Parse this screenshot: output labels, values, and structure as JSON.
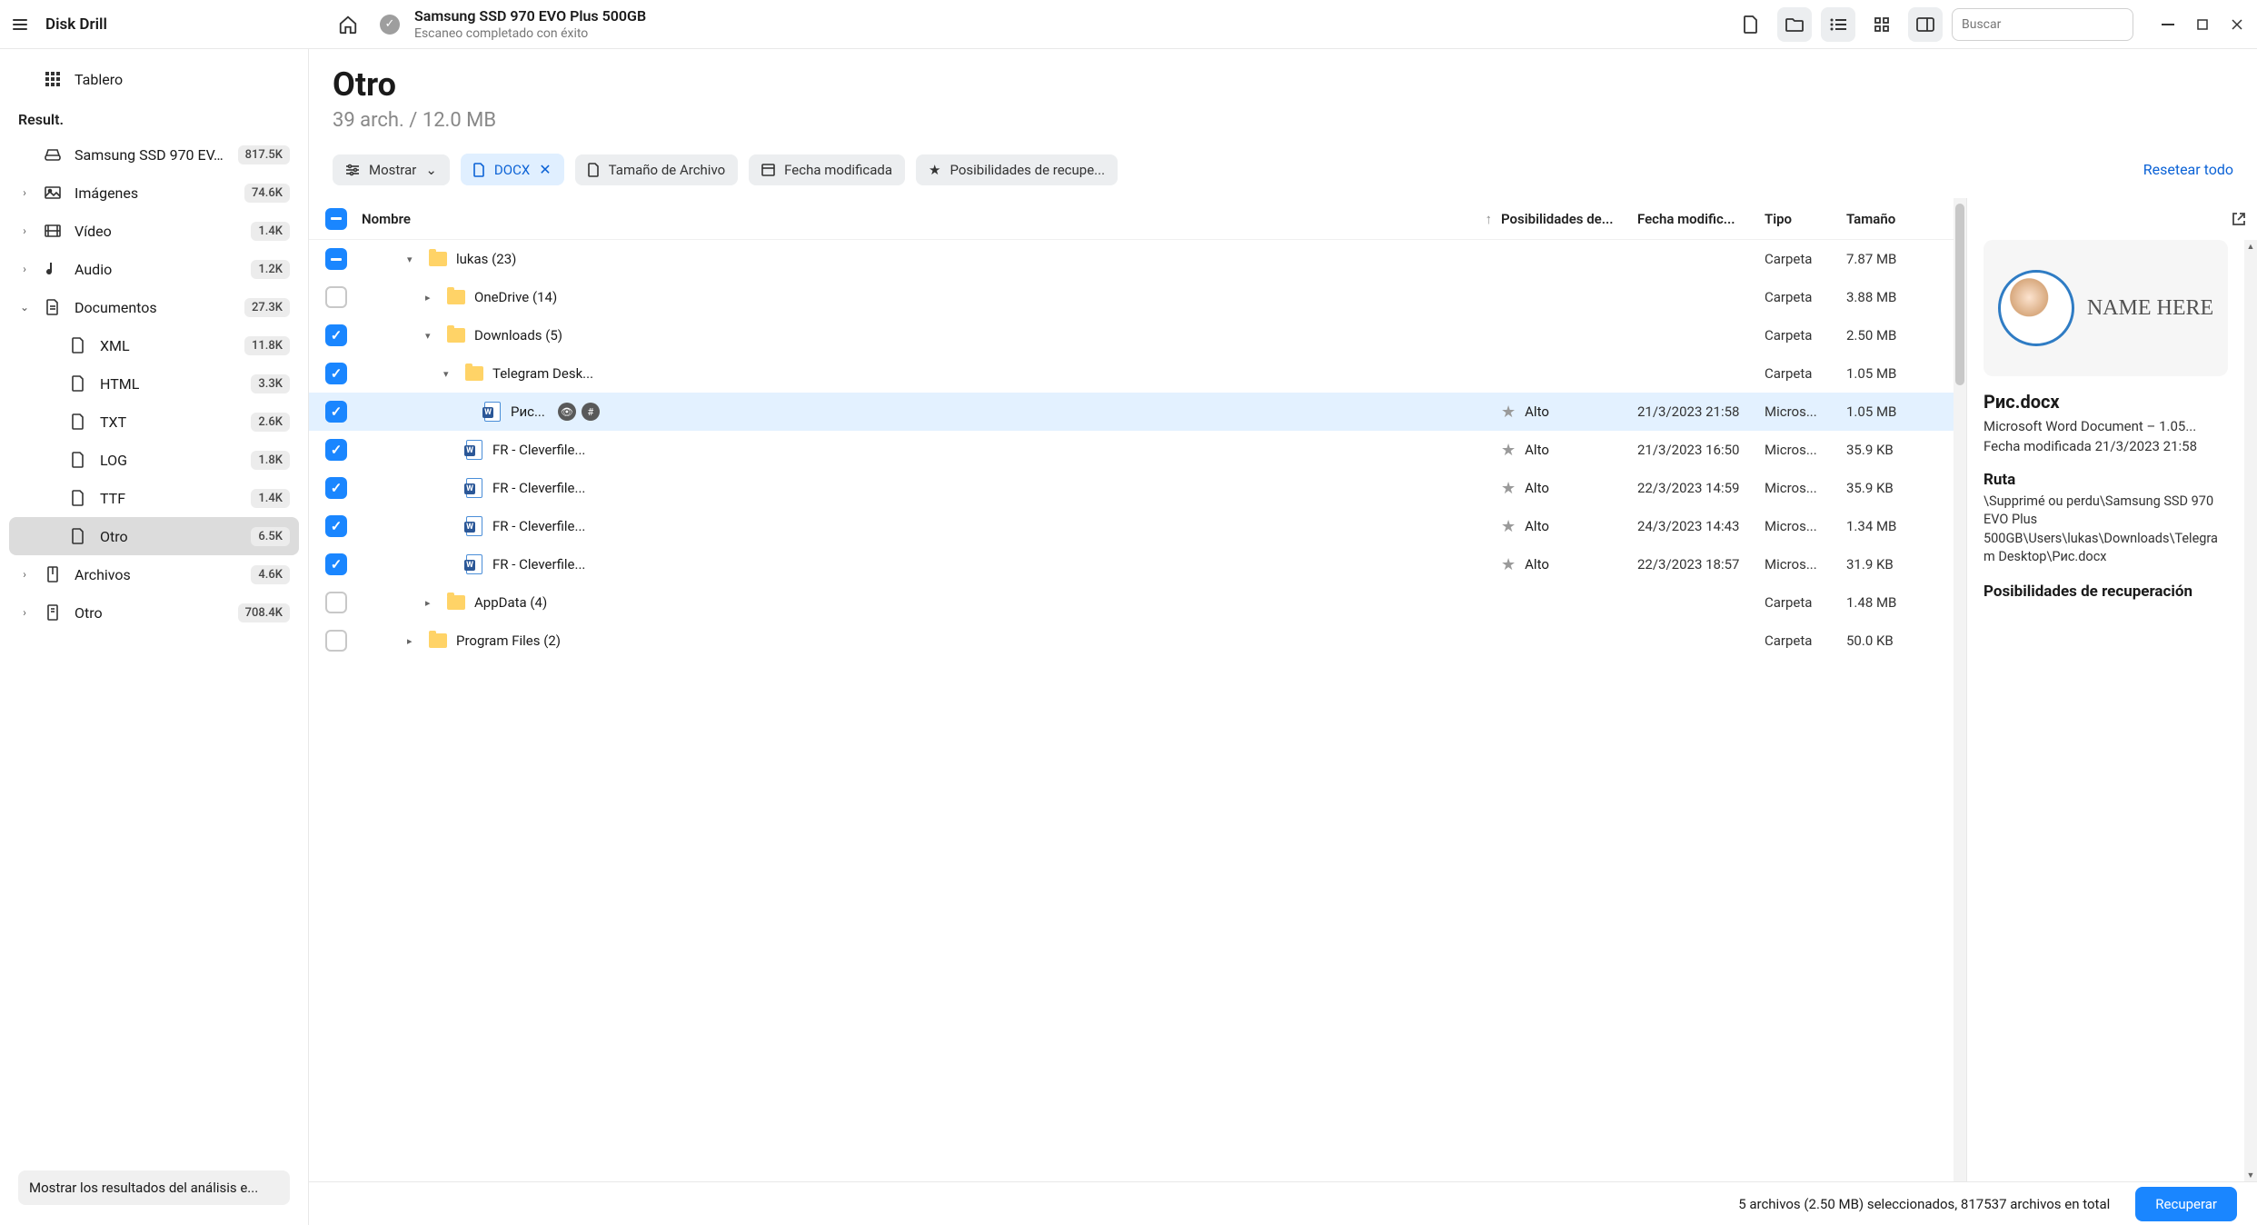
{
  "app": {
    "title": "Disk Drill"
  },
  "titlebar": {
    "disk_name": "Samsung SSD 970 EVO Plus 500GB",
    "scan_status": "Escaneo completado con éxito",
    "search_placeholder": "Buscar"
  },
  "sidebar": {
    "dashboard_label": "Tablero",
    "result_label": "Result.",
    "disk": {
      "label": "Samsung SSD 970 EV...",
      "count": "817.5K"
    },
    "imagenes": {
      "label": "Imágenes",
      "count": "74.6K"
    },
    "video": {
      "label": "Vídeo",
      "count": "1.4K"
    },
    "audio": {
      "label": "Audio",
      "count": "1.2K"
    },
    "documentos": {
      "label": "Documentos",
      "count": "27.3K"
    },
    "xml": {
      "label": "XML",
      "count": "11.8K"
    },
    "html": {
      "label": "HTML",
      "count": "3.3K"
    },
    "txt": {
      "label": "TXT",
      "count": "2.6K"
    },
    "log": {
      "label": "LOG",
      "count": "1.8K"
    },
    "ttf": {
      "label": "TTF",
      "count": "1.4K"
    },
    "otro_doc": {
      "label": "Otro",
      "count": "6.5K"
    },
    "archivos": {
      "label": "Archivos",
      "count": "4.6K"
    },
    "otro": {
      "label": "Otro",
      "count": "708.4K"
    },
    "bottom_btn": "Mostrar los resultados del análisis e..."
  },
  "content": {
    "title": "Otro",
    "subtitle": "39 arch. / 12.0 MB"
  },
  "filters": {
    "show": "Mostrar",
    "docx": "DOCX",
    "size": "Tamaño de Archivo",
    "date": "Fecha modificada",
    "chance": "Posibilidades de recupe...",
    "reset": "Resetear todo"
  },
  "columns": {
    "name": "Nombre",
    "chance": "Posibilidades de...",
    "date": "Fecha modific...",
    "type": "Tipo",
    "size": "Tamaño"
  },
  "rows": [
    {
      "cb": "partial",
      "indent": 1,
      "expand": "down",
      "kind": "folder",
      "name": "lukas (23)",
      "type": "Carpeta",
      "size": "7.87 MB"
    },
    {
      "cb": "empty",
      "indent": 2,
      "expand": "right",
      "kind": "folder",
      "name": "OneDrive (14)",
      "type": "Carpeta",
      "size": "3.88 MB"
    },
    {
      "cb": "checked",
      "indent": 2,
      "expand": "down",
      "kind": "folder",
      "name": "Downloads (5)",
      "type": "Carpeta",
      "size": "2.50 MB"
    },
    {
      "cb": "checked",
      "indent": 3,
      "expand": "down",
      "kind": "folder",
      "name": "Telegram Desk...",
      "type": "Carpeta",
      "size": "1.05 MB"
    },
    {
      "cb": "checked",
      "indent": 4,
      "kind": "docx",
      "name": "Рис...",
      "badges": true,
      "chance": "Alto",
      "date": "21/3/2023 21:58",
      "type": "Micros...",
      "size": "1.05 MB",
      "selected": true
    },
    {
      "cb": "checked",
      "indent": 3,
      "kind": "docx",
      "name": "FR - Cleverfile...",
      "chance": "Alto",
      "date": "21/3/2023 16:50",
      "type": "Micros...",
      "size": "35.9 KB"
    },
    {
      "cb": "checked",
      "indent": 3,
      "kind": "docx",
      "name": "FR - Cleverfile...",
      "chance": "Alto",
      "date": "22/3/2023 14:59",
      "type": "Micros...",
      "size": "35.9 KB"
    },
    {
      "cb": "checked",
      "indent": 3,
      "kind": "docx",
      "name": "FR - Cleverfile...",
      "chance": "Alto",
      "date": "24/3/2023 14:43",
      "type": "Micros...",
      "size": "1.34 MB"
    },
    {
      "cb": "checked",
      "indent": 3,
      "kind": "docx",
      "name": "FR - Cleverfile...",
      "chance": "Alto",
      "date": "22/3/2023 18:57",
      "type": "Micros...",
      "size": "31.9 KB"
    },
    {
      "cb": "empty",
      "indent": 2,
      "expand": "right",
      "kind": "folder",
      "name": "AppData (4)",
      "type": "Carpeta",
      "size": "1.48 MB"
    },
    {
      "cb": "empty",
      "indent": 1,
      "expand": "right",
      "kind": "folder",
      "name": "Program Files (2)",
      "type": "Carpeta",
      "size": "50.0 KB"
    }
  ],
  "preview": {
    "name_here": "NAME HERE",
    "title": "Рис.docx",
    "meta1": "Microsoft Word Document – 1.05...",
    "meta2": "Fecha modificada 21/3/2023 21:58",
    "path_label": "Ruta",
    "path": "\\Supprimé ou perdu\\Samsung SSD 970 EVO Plus 500GB\\Users\\lukas\\Downloads\\Telegram Desktop\\Рис.docx",
    "chance_label": "Posibilidades de recuperación"
  },
  "footer": {
    "status": "5 archivos (2.50 MB) seleccionados, 817537 archivos en total",
    "recover": "Recuperar"
  }
}
